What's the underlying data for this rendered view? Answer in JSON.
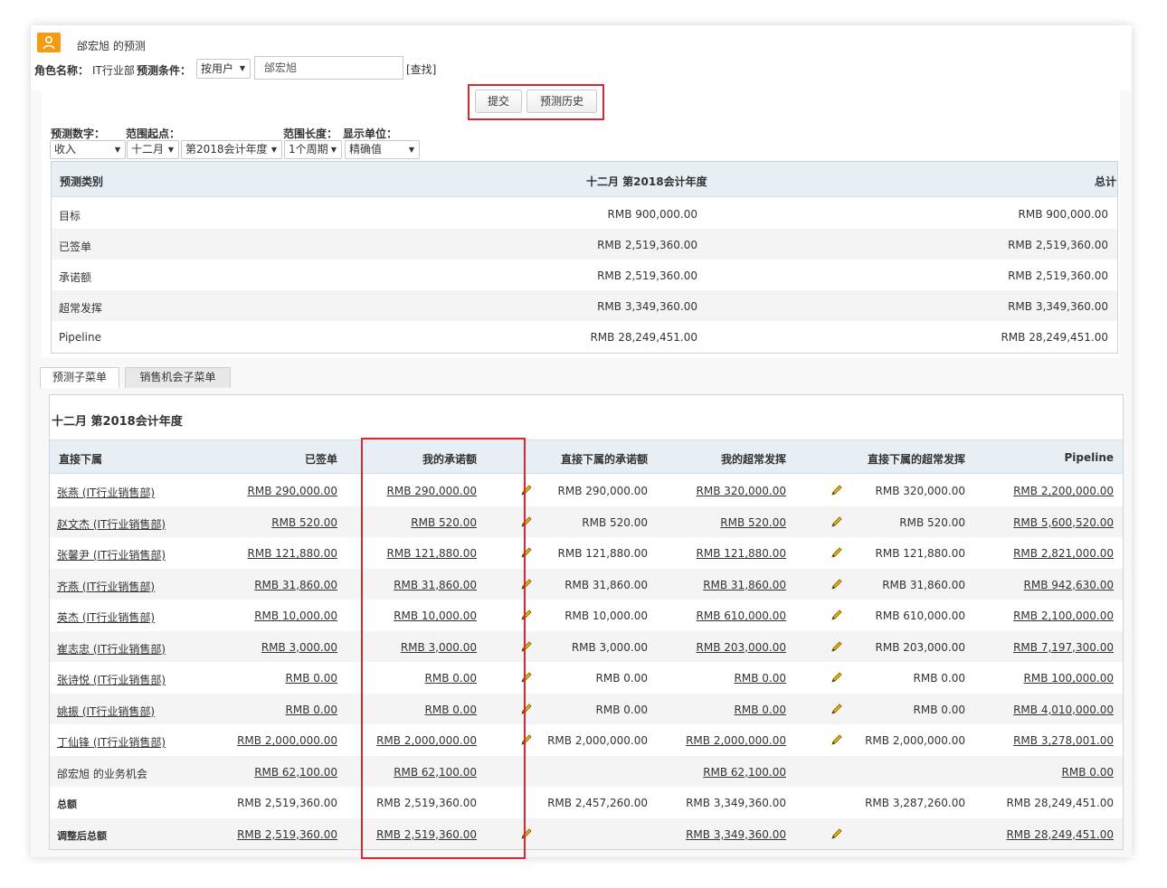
{
  "header": {
    "title": "邰宏旭 的预测",
    "role_label": "角色名称：",
    "role_value": "IT行业部",
    "condition_label": "预测条件：",
    "condition_select": "按用户",
    "user_input": "邰宏旭",
    "find_link": "[查找]"
  },
  "buttons": {
    "submit": "提交",
    "history": "预测历史"
  },
  "filters": {
    "number_label": "预测数字：",
    "range_start_label": "范围起点：",
    "range_length_label": "范围长度：",
    "unit_label": "显示单位：",
    "number_value": "收入",
    "month_value": "十二月",
    "year_value": "第2018会计年度",
    "length_value": "1个周期",
    "unit_value": "精确值"
  },
  "summary": {
    "headers": [
      "预测类别",
      "十二月 第2018会计年度",
      "总计"
    ],
    "rows": [
      {
        "category": "目标",
        "period": "RMB 900,000.00",
        "total": "RMB 900,000.00"
      },
      {
        "category": "已签单",
        "period": "RMB 2,519,360.00",
        "total": "RMB 2,519,360.00"
      },
      {
        "category": "承诺额",
        "period": "RMB 2,519,360.00",
        "total": "RMB 2,519,360.00"
      },
      {
        "category": "超常发挥",
        "period": "RMB 3,349,360.00",
        "total": "RMB 3,349,360.00"
      },
      {
        "category": "Pipeline",
        "period": "RMB 28,249,451.00",
        "total": "RMB 28,249,451.00"
      }
    ]
  },
  "tabs": [
    "预测子菜单",
    "销售机会子菜单"
  ],
  "detail": {
    "period_title": "十二月 第2018会计年度",
    "headers": [
      "直接下属",
      "已签单",
      "我的承诺额",
      "直接下属的承诺额",
      "我的超常发挥",
      "直接下属的超常发挥",
      "Pipeline"
    ],
    "rows": [
      {
        "name": "张燕 (IT行业销售部)",
        "closed": "RMB 290,000.00",
        "my_commit": "RMB 290,000.00",
        "sub_commit": "RMB 290,000.00",
        "my_best": "RMB 320,000.00",
        "sub_best": "RMB 320,000.00",
        "pipeline": "RMB 2,200,000.00"
      },
      {
        "name": "赵文杰 (IT行业销售部)",
        "closed": "RMB 520.00",
        "my_commit": "RMB 520.00",
        "sub_commit": "RMB 520.00",
        "my_best": "RMB 520.00",
        "sub_best": "RMB 520.00",
        "pipeline": "RMB 5,600,520.00"
      },
      {
        "name": "张馨尹 (IT行业销售部)",
        "closed": "RMB 121,880.00",
        "my_commit": "RMB 121,880.00",
        "sub_commit": "RMB 121,880.00",
        "my_best": "RMB 121,880.00",
        "sub_best": "RMB 121,880.00",
        "pipeline": "RMB 2,821,000.00"
      },
      {
        "name": "齐燕 (IT行业销售部)",
        "closed": "RMB 31,860.00",
        "my_commit": "RMB 31,860.00",
        "sub_commit": "RMB 31,860.00",
        "my_best": "RMB 31,860.00",
        "sub_best": "RMB 31,860.00",
        "pipeline": "RMB 942,630.00"
      },
      {
        "name": "英杰 (IT行业销售部)",
        "closed": "RMB 10,000.00",
        "my_commit": "RMB 10,000.00",
        "sub_commit": "RMB 10,000.00",
        "my_best": "RMB 610,000.00",
        "sub_best": "RMB 610,000.00",
        "pipeline": "RMB 2,100,000.00"
      },
      {
        "name": "崔志忠 (IT行业销售部)",
        "closed": "RMB 3,000.00",
        "my_commit": "RMB 3,000.00",
        "sub_commit": "RMB 3,000.00",
        "my_best": "RMB 203,000.00",
        "sub_best": "RMB 203,000.00",
        "pipeline": "RMB 7,197,300.00"
      },
      {
        "name": "张诗悦 (IT行业销售部)",
        "closed": "RMB 0.00",
        "my_commit": "RMB 0.00",
        "sub_commit": "RMB 0.00",
        "my_best": "RMB 0.00",
        "sub_best": "RMB 0.00",
        "pipeline": "RMB 100,000.00"
      },
      {
        "name": "姚振 (IT行业销售部)",
        "closed": "RMB 0.00",
        "my_commit": "RMB 0.00",
        "sub_commit": "RMB 0.00",
        "my_best": "RMB 0.00",
        "sub_best": "RMB 0.00",
        "pipeline": "RMB 4,010,000.00"
      },
      {
        "name": "丁仙锋 (IT行业销售部)",
        "closed": "RMB 2,000,000.00",
        "my_commit": "RMB 2,000,000.00",
        "sub_commit": "RMB 2,000,000.00",
        "my_best": "RMB 2,000,000.00",
        "sub_best": "RMB 2,000,000.00",
        "pipeline": "RMB 3,278,001.00"
      }
    ],
    "own_row": {
      "name": "邰宏旭 的业务机会",
      "closed": "RMB 62,100.00",
      "my_commit": "RMB 62,100.00",
      "my_best": "RMB 62,100.00",
      "pipeline": "RMB 0.00"
    },
    "total_row": {
      "name": "总额",
      "closed": "RMB 2,519,360.00",
      "my_commit": "RMB 2,519,360.00",
      "sub_commit": "RMB 2,457,260.00",
      "my_best": "RMB 3,349,360.00",
      "sub_best": "RMB 3,287,260.00",
      "pipeline": "RMB 28,249,451.00"
    },
    "adjusted_row": {
      "name": "调整后总额",
      "closed": "RMB 2,519,360.00",
      "my_commit": "RMB 2,519,360.00",
      "my_best": "RMB 3,349,360.00",
      "pipeline": "RMB 28,249,451.00"
    }
  },
  "colors": {
    "accent": "#f39c12",
    "highlight_box": "#d9282f",
    "header_bg": "#e8eff4"
  }
}
